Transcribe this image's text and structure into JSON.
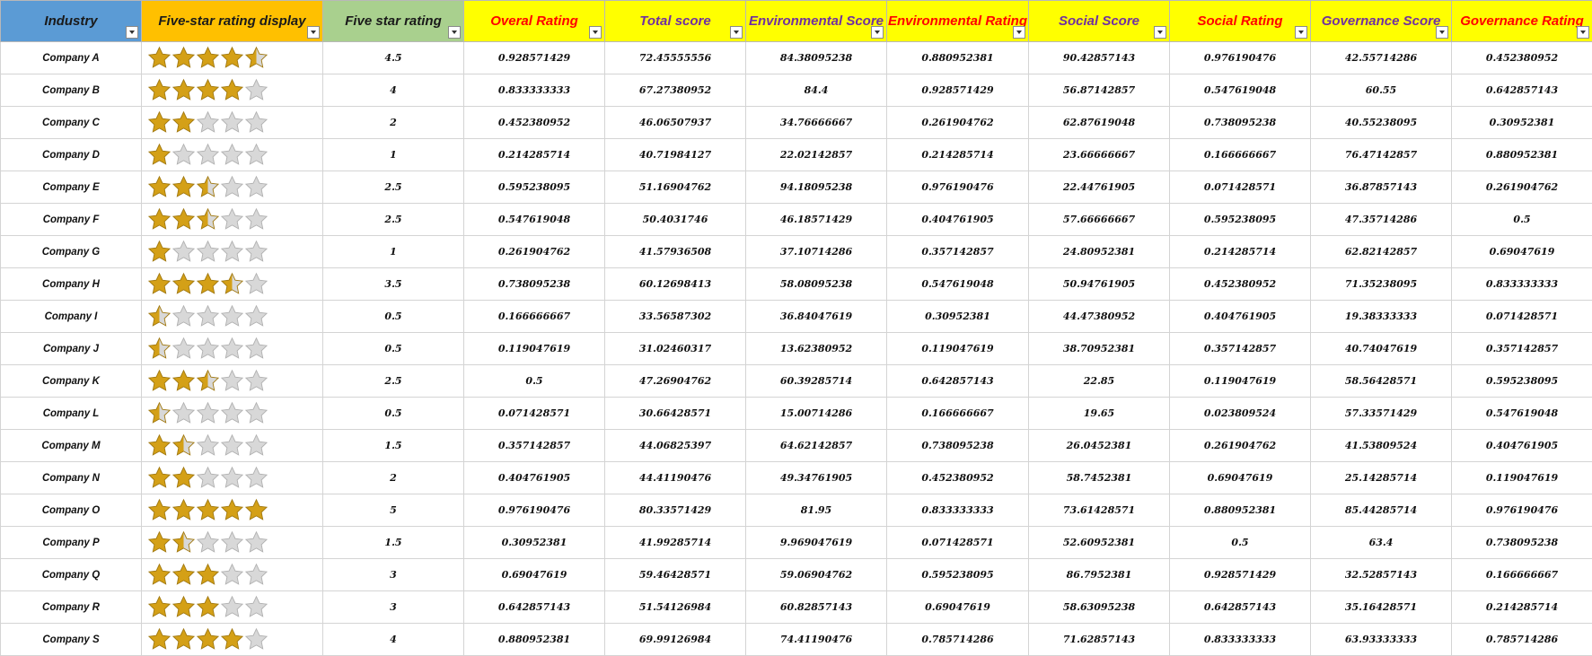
{
  "colors": {
    "header_industry_bg": "#5b9bd5",
    "header_display_bg": "#ffc000",
    "header_rating_bg": "#a9d08e",
    "header_yellow_bg": "#ffff00",
    "text_red": "#ff0000",
    "text_purple": "#7030a0",
    "star_gold": "#d4a017",
    "star_gray": "#d8d8d8"
  },
  "headers": [
    {
      "label": "Industry",
      "bg": "#5b9bd5",
      "color": "#1a1a1a"
    },
    {
      "label": "Five-star rating display",
      "bg": "#ffc000",
      "color": "#1a1a1a"
    },
    {
      "label": "Five star rating",
      "bg": "#a9d08e",
      "color": "#1a1a1a"
    },
    {
      "label": "Overal Rating",
      "bg": "#ffff00",
      "color": "#ff0000"
    },
    {
      "label": "Total score",
      "bg": "#ffff00",
      "color": "#7030a0"
    },
    {
      "label": "Environmental Score",
      "bg": "#ffff00",
      "color": "#7030a0"
    },
    {
      "label": "Environmental Rating",
      "bg": "#ffff00",
      "color": "#ff0000"
    },
    {
      "label": "Social Score",
      "bg": "#ffff00",
      "color": "#7030a0"
    },
    {
      "label": "Social Rating",
      "bg": "#ffff00",
      "color": "#ff0000"
    },
    {
      "label": "Governance Score",
      "bg": "#ffff00",
      "color": "#7030a0"
    },
    {
      "label": "Governance Rating",
      "bg": "#ffff00",
      "color": "#ff0000"
    }
  ],
  "rows": [
    {
      "name": "Company A",
      "stars": 4.5,
      "rating": "4.5",
      "overall": "0.928571429",
      "total": "72.45555556",
      "env_score": "84.38095238",
      "env_rating": "0.880952381",
      "soc_score": "90.42857143",
      "soc_rating": "0.976190476",
      "gov_score": "42.55714286",
      "gov_rating": "0.452380952"
    },
    {
      "name": "Company B",
      "stars": 4,
      "rating": "4",
      "overall": "0.833333333",
      "total": "67.27380952",
      "env_score": "84.4",
      "env_rating": "0.928571429",
      "soc_score": "56.87142857",
      "soc_rating": "0.547619048",
      "gov_score": "60.55",
      "gov_rating": "0.642857143"
    },
    {
      "name": "Company C",
      "stars": 2,
      "rating": "2",
      "overall": "0.452380952",
      "total": "46.06507937",
      "env_score": "34.76666667",
      "env_rating": "0.261904762",
      "soc_score": "62.87619048",
      "soc_rating": "0.738095238",
      "gov_score": "40.55238095",
      "gov_rating": "0.30952381"
    },
    {
      "name": "Company D",
      "stars": 1,
      "rating": "1",
      "overall": "0.214285714",
      "total": "40.71984127",
      "env_score": "22.02142857",
      "env_rating": "0.214285714",
      "soc_score": "23.66666667",
      "soc_rating": "0.166666667",
      "gov_score": "76.47142857",
      "gov_rating": "0.880952381"
    },
    {
      "name": "Company E",
      "stars": 2.5,
      "rating": "2.5",
      "overall": "0.595238095",
      "total": "51.16904762",
      "env_score": "94.18095238",
      "env_rating": "0.976190476",
      "soc_score": "22.44761905",
      "soc_rating": "0.071428571",
      "gov_score": "36.87857143",
      "gov_rating": "0.261904762"
    },
    {
      "name": "Company F",
      "stars": 2.5,
      "rating": "2.5",
      "overall": "0.547619048",
      "total": "50.4031746",
      "env_score": "46.18571429",
      "env_rating": "0.404761905",
      "soc_score": "57.66666667",
      "soc_rating": "0.595238095",
      "gov_score": "47.35714286",
      "gov_rating": "0.5"
    },
    {
      "name": "Company G",
      "stars": 1,
      "rating": "1",
      "overall": "0.261904762",
      "total": "41.57936508",
      "env_score": "37.10714286",
      "env_rating": "0.357142857",
      "soc_score": "24.80952381",
      "soc_rating": "0.214285714",
      "gov_score": "62.82142857",
      "gov_rating": "0.69047619"
    },
    {
      "name": "Company H",
      "stars": 3.5,
      "rating": "3.5",
      "overall": "0.738095238",
      "total": "60.12698413",
      "env_score": "58.08095238",
      "env_rating": "0.547619048",
      "soc_score": "50.94761905",
      "soc_rating": "0.452380952",
      "gov_score": "71.35238095",
      "gov_rating": "0.833333333"
    },
    {
      "name": "Company I",
      "stars": 0.5,
      "rating": "0.5",
      "overall": "0.166666667",
      "total": "33.56587302",
      "env_score": "36.84047619",
      "env_rating": "0.30952381",
      "soc_score": "44.47380952",
      "soc_rating": "0.404761905",
      "gov_score": "19.38333333",
      "gov_rating": "0.071428571"
    },
    {
      "name": "Company J",
      "stars": 0.5,
      "rating": "0.5",
      "overall": "0.119047619",
      "total": "31.02460317",
      "env_score": "13.62380952",
      "env_rating": "0.119047619",
      "soc_score": "38.70952381",
      "soc_rating": "0.357142857",
      "gov_score": "40.74047619",
      "gov_rating": "0.357142857"
    },
    {
      "name": "Company K",
      "stars": 2.5,
      "rating": "2.5",
      "overall": "0.5",
      "total": "47.26904762",
      "env_score": "60.39285714",
      "env_rating": "0.642857143",
      "soc_score": "22.85",
      "soc_rating": "0.119047619",
      "gov_score": "58.56428571",
      "gov_rating": "0.595238095"
    },
    {
      "name": "Company L",
      "stars": 0.5,
      "rating": "0.5",
      "overall": "0.071428571",
      "total": "30.66428571",
      "env_score": "15.00714286",
      "env_rating": "0.166666667",
      "soc_score": "19.65",
      "soc_rating": "0.023809524",
      "gov_score": "57.33571429",
      "gov_rating": "0.547619048"
    },
    {
      "name": "Company M",
      "stars": 1.5,
      "rating": "1.5",
      "overall": "0.357142857",
      "total": "44.06825397",
      "env_score": "64.62142857",
      "env_rating": "0.738095238",
      "soc_score": "26.0452381",
      "soc_rating": "0.261904762",
      "gov_score": "41.53809524",
      "gov_rating": "0.404761905"
    },
    {
      "name": "Company N",
      "stars": 2,
      "rating": "2",
      "overall": "0.404761905",
      "total": "44.41190476",
      "env_score": "49.34761905",
      "env_rating": "0.452380952",
      "soc_score": "58.7452381",
      "soc_rating": "0.69047619",
      "gov_score": "25.14285714",
      "gov_rating": "0.119047619"
    },
    {
      "name": "Company O",
      "stars": 5,
      "rating": "5",
      "overall": "0.976190476",
      "total": "80.33571429",
      "env_score": "81.95",
      "env_rating": "0.833333333",
      "soc_score": "73.61428571",
      "soc_rating": "0.880952381",
      "gov_score": "85.44285714",
      "gov_rating": "0.976190476"
    },
    {
      "name": "Company P",
      "stars": 1.5,
      "rating": "1.5",
      "overall": "0.30952381",
      "total": "41.99285714",
      "env_score": "9.969047619",
      "env_rating": "0.071428571",
      "soc_score": "52.60952381",
      "soc_rating": "0.5",
      "gov_score": "63.4",
      "gov_rating": "0.738095238"
    },
    {
      "name": "Company Q",
      "stars": 3,
      "rating": "3",
      "overall": "0.69047619",
      "total": "59.46428571",
      "env_score": "59.06904762",
      "env_rating": "0.595238095",
      "soc_score": "86.7952381",
      "soc_rating": "0.928571429",
      "gov_score": "32.52857143",
      "gov_rating": "0.166666667"
    },
    {
      "name": "Company R",
      "stars": 3,
      "rating": "3",
      "overall": "0.642857143",
      "total": "51.54126984",
      "env_score": "60.82857143",
      "env_rating": "0.69047619",
      "soc_score": "58.63095238",
      "soc_rating": "0.642857143",
      "gov_score": "35.16428571",
      "gov_rating": "0.214285714"
    },
    {
      "name": "Company S",
      "stars": 4,
      "rating": "4",
      "overall": "0.880952381",
      "total": "69.99126984",
      "env_score": "74.41190476",
      "env_rating": "0.785714286",
      "soc_score": "71.62857143",
      "soc_rating": "0.833333333",
      "gov_score": "63.93333333",
      "gov_rating": "0.785714286"
    }
  ]
}
